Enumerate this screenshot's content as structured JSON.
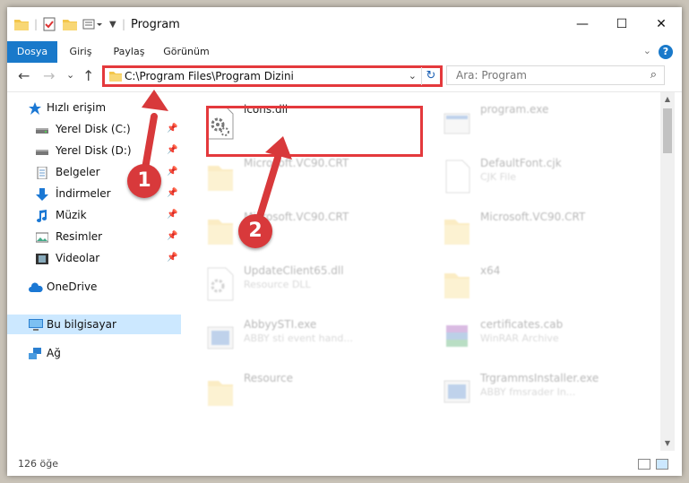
{
  "window": {
    "title": "Program",
    "controls": {
      "minimize": "—",
      "maximize": "☐",
      "close": "✕"
    }
  },
  "ribbon": {
    "tabs": [
      "Dosya",
      "Giriş",
      "Paylaş",
      "Görünüm"
    ],
    "help": "?"
  },
  "navigation": {
    "back": "←",
    "forward": "→",
    "recent": "⌄",
    "up": "↑",
    "address": "C:\\Program Files\\Program Dizini",
    "search_placeholder": "Ara: Program"
  },
  "sidebar": {
    "items": [
      {
        "label": "Hızlı erişim",
        "icon": "star-icon"
      },
      {
        "label": "Yerel Disk (C:)",
        "icon": "drive-icon",
        "pinned": true
      },
      {
        "label": "Yerel Disk (D:)",
        "icon": "drive-icon",
        "pinned": true
      },
      {
        "label": "Belgeler",
        "icon": "documents-icon",
        "pinned": true
      },
      {
        "label": "İndirmeler",
        "icon": "download-icon",
        "pinned": true
      },
      {
        "label": "Müzik",
        "icon": "music-icon",
        "pinned": true
      },
      {
        "label": "Resimler",
        "icon": "pictures-icon",
        "pinned": true
      },
      {
        "label": "Videolar",
        "icon": "videos-icon",
        "pinned": true
      },
      {
        "label": "OneDrive",
        "icon": "cloud-icon"
      },
      {
        "label": "Bu bilgisayar",
        "icon": "computer-icon",
        "selected": true
      },
      {
        "label": "Ağ",
        "icon": "network-icon"
      }
    ]
  },
  "files": [
    {
      "name": "icons.dll",
      "desc": "",
      "icon": "dll-gear-icon",
      "highlighted": true
    },
    {
      "name": "program.exe",
      "desc": "",
      "icon": "exe-icon"
    },
    {
      "name": "Microsoft.VC90.CRT",
      "desc": "",
      "icon": "folder-icon"
    },
    {
      "name": "DefaultFont.cjk",
      "desc": "CJK File",
      "icon": "blank-file-icon"
    },
    {
      "name": "Microsoft.VC90.CRT",
      "desc": "",
      "icon": "folder-icon"
    },
    {
      "name": "Microsoft.VC90.CRT",
      "desc": "",
      "icon": "folder-icon"
    },
    {
      "name": "UpdateClient65.dll",
      "desc": "Resource DLL",
      "icon": "dll-gear-icon"
    },
    {
      "name": "x64",
      "desc": "",
      "icon": "folder-icon"
    },
    {
      "name": "AbbyySTI.exe",
      "desc": "ABBY sti event hand...",
      "icon": "exe-icon"
    },
    {
      "name": "certificates.cab",
      "desc": "WinRAR Archive",
      "icon": "archive-icon"
    },
    {
      "name": "Resource",
      "desc": "",
      "icon": "folder-icon"
    },
    {
      "name": "TrgrammsInstaller.exe",
      "desc": "ABBY fmsrader In...",
      "icon": "exe-icon"
    }
  ],
  "status": {
    "count": "126 öğe"
  },
  "annotations": [
    "1",
    "2"
  ],
  "colors": {
    "accent": "#1979ca",
    "highlight": "#e4393c",
    "badge": "#d8393b",
    "selected": "#cce8ff"
  }
}
